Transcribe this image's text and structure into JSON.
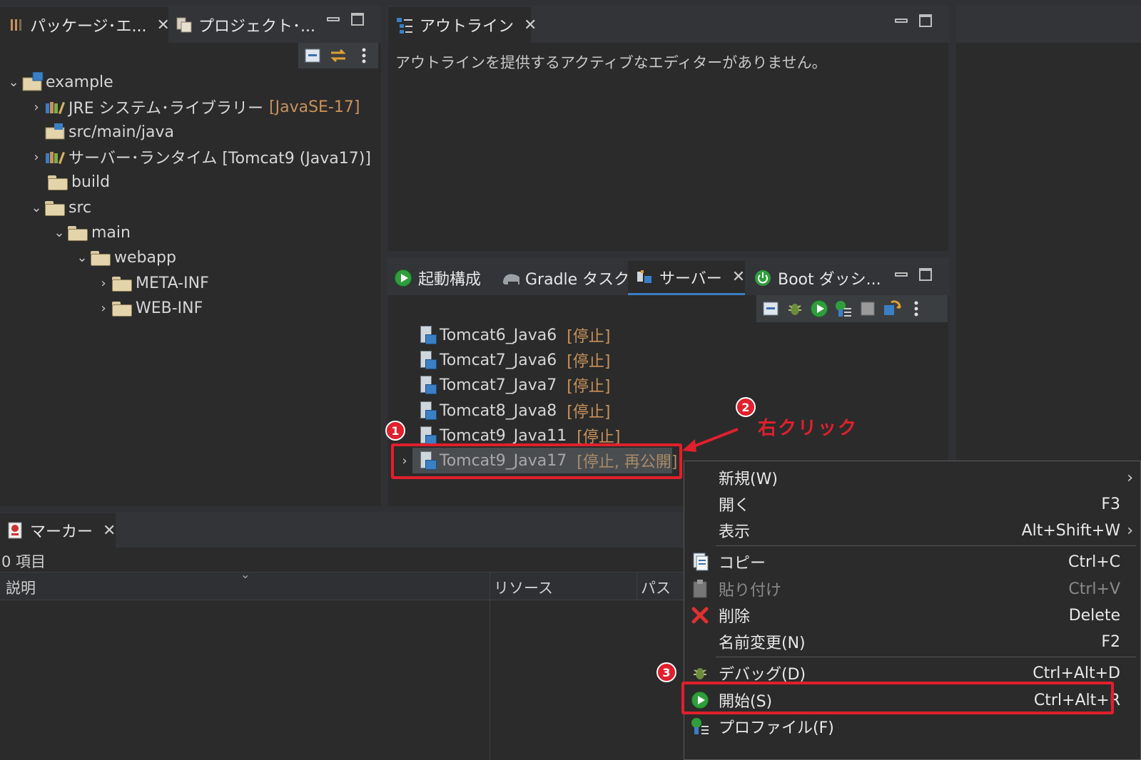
{
  "package_explorer": {
    "tab_label": "パッケージ･エ...",
    "tab2_label": "プロジェクト･...",
    "tree": [
      {
        "label": "example"
      },
      {
        "label": "JRE システム･ライブラリー",
        "decor": "[JavaSE-17]"
      },
      {
        "label": "src/main/java"
      },
      {
        "label": "サーバー･ランタイム [Tomcat9 (Java17)]"
      },
      {
        "label": "build"
      },
      {
        "label": "src"
      },
      {
        "label": "main"
      },
      {
        "label": "webapp"
      },
      {
        "label": "META-INF"
      },
      {
        "label": "WEB-INF"
      }
    ]
  },
  "outline": {
    "tab_label": "アウトライン",
    "message": "アウトラインを提供するアクティブなエディターがありません。"
  },
  "servers_view": {
    "tabs": [
      "起動構成",
      "Gradle タスク",
      "サーバー",
      "Boot ダッシ..."
    ],
    "servers": [
      {
        "name": "Tomcat6_Java6",
        "status": "[停止]"
      },
      {
        "name": "Tomcat7_Java6",
        "status": "[停止]"
      },
      {
        "name": "Tomcat7_Java7",
        "status": "[停止]"
      },
      {
        "name": "Tomcat8_Java8",
        "status": "[停止]"
      },
      {
        "name": "Tomcat9_Java11",
        "status": "[停止]"
      },
      {
        "name": "Tomcat9_Java17",
        "status": "[停止, 再公開]"
      }
    ]
  },
  "markers": {
    "tab_label": "マーカー",
    "count": "0 項目",
    "columns": [
      "説明",
      "リソース",
      "パス"
    ]
  },
  "context_menu": {
    "items": [
      {
        "label": "新規(W)",
        "shortcut": "",
        "submenu": true
      },
      {
        "label": "開く",
        "shortcut": "F3"
      },
      {
        "label": "表示",
        "shortcut": "Alt+Shift+W",
        "submenu": true
      },
      {
        "label": "コピー",
        "shortcut": "Ctrl+C"
      },
      {
        "label": "貼り付け",
        "shortcut": "Ctrl+V",
        "disabled": true
      },
      {
        "label": "削除",
        "shortcut": "Delete"
      },
      {
        "label": "名前変更(N)",
        "shortcut": "F2"
      },
      {
        "label": "デバッグ(D)",
        "shortcut": "Ctrl+Alt+D"
      },
      {
        "label": "開始(S)",
        "shortcut": "Ctrl+Alt+R"
      },
      {
        "label": "プロファイル(F)",
        "shortcut": ""
      }
    ]
  },
  "annotations": {
    "badge1": "1",
    "badge2": "2",
    "badge3": "3",
    "right_click_label": "右クリック"
  },
  "colors": {
    "highlight_red": "#e0202c",
    "decoration": "#c9925a",
    "background": "#2b2b2b"
  }
}
